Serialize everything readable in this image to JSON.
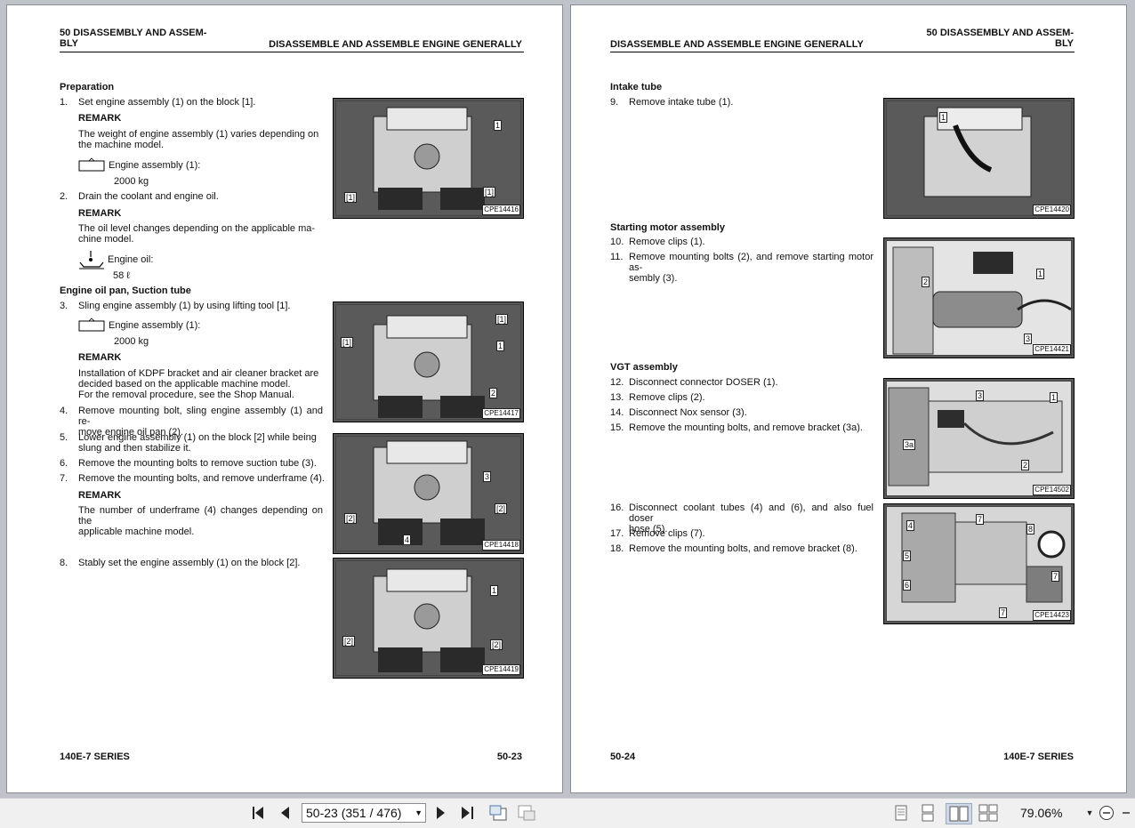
{
  "left_page": {
    "header_left_line1": "50 DISASSEMBLY AND ASSEM-",
    "header_left_line2": "BLY",
    "header_right": "DISASSEMBLE AND ASSEMBLE ENGINE GENERALLY",
    "sec_preparation": "Preparation",
    "s1_n": "1.",
    "s1_t": "Set engine assembly (1) on the block [1].",
    "remark": "REMARK",
    "r1_l1": "The weight of engine assembly (1) varies depending on",
    "r1_l2": "the machine model.",
    "w1_label": "Engine assembly (1):",
    "w1_value": "2000 kg",
    "s2_n": "2.",
    "s2_t": "Drain the coolant and engine oil.",
    "r2_l1": "The oil level changes depending on the applicable ma-",
    "r2_l2": "chine model.",
    "oil_label": "Engine oil:",
    "oil_value": "58 ℓ",
    "sec_oilpan": "Engine oil pan, Suction tube",
    "s3_n": "3.",
    "s3_t": "Sling engine assembly (1) by using lifting tool [1].",
    "w2_label": "Engine assembly (1):",
    "w2_value": "2000 kg",
    "r3_l1": "Installation of KDPF bracket and air cleaner bracket are",
    "r3_l2": "decided based on the applicable machine model.",
    "r3_l3": "For the removal procedure, see the Shop Manual.",
    "s4_n": "4.",
    "s4_l1": "Remove mounting bolt, sling engine assembly (1) and re-",
    "s4_l2": "move engine oil pan (2).",
    "s5_n": "5.",
    "s5_l1": "Lower engine assembly (1) on the block [2] while being",
    "s5_l2": "slung and then stabilize it.",
    "s6_n": "6.",
    "s6_t": "Remove the mounting bolts to remove suction tube (3).",
    "s7_n": "7.",
    "s7_t": "Remove the mounting bolts, and remove underframe (4).",
    "r4_l1": "The number of underframe (4) changes depending on the",
    "r4_l2": "applicable machine model.",
    "s8_n": "8.",
    "s8_t": "Stably set the engine assembly (1) on the block [2].",
    "figs": [
      {
        "cap": "CPE14416",
        "labels": [
          "1",
          "[1]",
          "[1]"
        ]
      },
      {
        "cap": "CPE14417",
        "labels": [
          "[1]",
          "[1]",
          "1",
          "2"
        ]
      },
      {
        "cap": "CPE14418",
        "labels": [
          "3",
          "[2]",
          "[2]",
          "4"
        ]
      },
      {
        "cap": "CPE14419",
        "labels": [
          "1",
          "[2]",
          "[2]"
        ]
      }
    ],
    "footer_left": "140E-7 SERIES",
    "footer_right": "50-23"
  },
  "right_page": {
    "header_left": "DISASSEMBLE AND ASSEMBLE ENGINE GENERALLY",
    "header_right_line1": "50 DISASSEMBLY AND ASSEM-",
    "header_right_line2": "BLY",
    "sec_intake": "Intake tube",
    "s9_n": "9.",
    "s9_t": "Remove intake tube (1).",
    "sec_starting": "Starting motor assembly",
    "s10_n": "10.",
    "s10_t": "Remove clips (1).",
    "s11_n": "11.",
    "s11_l1": "Remove mounting bolts (2), and remove starting motor as-",
    "s11_l2": "sembly (3).",
    "sec_vgt": "VGT assembly",
    "s12_n": "12.",
    "s12_t": "Disconnect connector DOSER (1).",
    "s13_n": "13.",
    "s13_t": "Remove clips (2).",
    "s14_n": "14.",
    "s14_t": "Disconnect Nox sensor (3).",
    "s15_n": "15.",
    "s15_t": "Remove the mounting bolts, and remove bracket (3a).",
    "s16_n": "16.",
    "s16_l1": "Disconnect coolant tubes (4) and (6), and also fuel doser",
    "s16_l2": "hose (5).",
    "s17_n": "17.",
    "s17_t": "Remove clips (7).",
    "s18_n": "18.",
    "s18_t": "Remove the mounting bolts, and remove bracket (8).",
    "figs": [
      {
        "cap": "CPE14420",
        "labels": [
          "1"
        ]
      },
      {
        "cap": "CPE14421",
        "labels": [
          "2",
          "1",
          "3"
        ]
      },
      {
        "cap": "CPE14502",
        "labels": [
          "3",
          "1",
          "3a",
          "2"
        ]
      },
      {
        "cap": "CPE14423",
        "labels": [
          "4",
          "7",
          "8",
          "5",
          "6",
          "7",
          "7"
        ]
      }
    ],
    "footer_left": "50-24",
    "footer_right": "140E-7 SERIES"
  },
  "toolbar": {
    "page_field": "50-23 (351 / 476)",
    "zoom": "79.06%"
  }
}
